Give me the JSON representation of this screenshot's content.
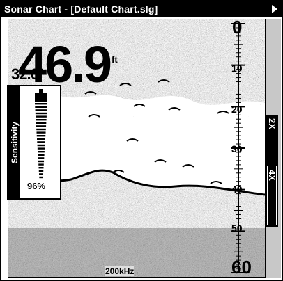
{
  "window": {
    "title": "Sonar Chart - [Default Chart.slg]"
  },
  "readout": {
    "depth": "46.9",
    "depth_unit": "ft",
    "temperature": "32.0°"
  },
  "sensitivity": {
    "label": "Sensitivity",
    "value_text": "96%",
    "level": 0.96
  },
  "frequency": "200kHz",
  "zoom": {
    "options": [
      "2X",
      "4X"
    ],
    "selected": "4X"
  },
  "depth_scale": {
    "labels": [
      "0",
      "10",
      "20",
      "30",
      "40",
      "50",
      "60"
    ]
  },
  "colors": {
    "titlebar": "#000000",
    "scalebar": "#c8c8c8",
    "ink": "#000000"
  }
}
